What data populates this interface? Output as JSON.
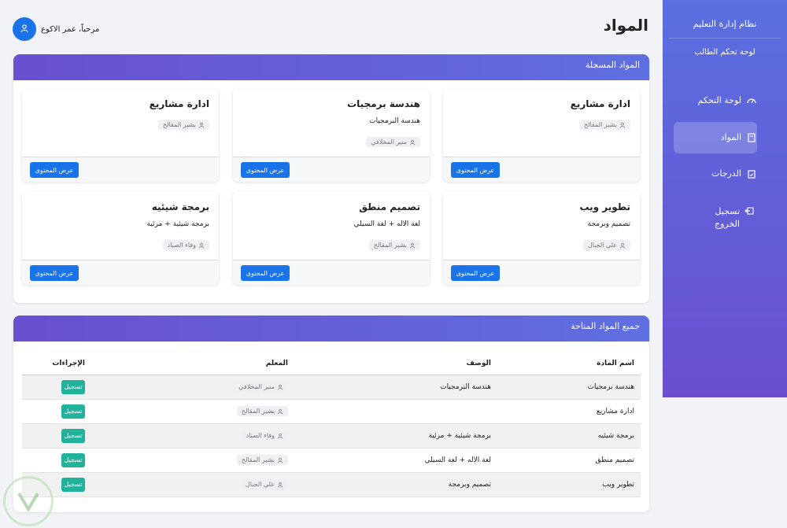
{
  "sidebar": {
    "brand": "نظام إدارة التعليم",
    "subtitle": "لوحة تحكم الطالب",
    "items": [
      {
        "label": "لوحة التحكم",
        "icon": "dashboard-gauge-icon"
      },
      {
        "label": "المواد",
        "icon": "book-icon"
      },
      {
        "label": "الدرجات",
        "icon": "clipboard-check-icon"
      },
      {
        "label": "تسجيل الخروج",
        "icon": "logout-icon"
      }
    ]
  },
  "header": {
    "title": "المواد",
    "greeting": "مرحباً، عمر الاكوع"
  },
  "registered": {
    "heading": "المواد المسجلة",
    "button_label": "عرض المحتوى",
    "cards": [
      {
        "title": "ادارة مشاريع",
        "description": "",
        "teacher": "بشير المقالح"
      },
      {
        "title": "هندسة برمجيات",
        "description": "هندسة البرمجيات",
        "teacher": "منير المخلافي"
      },
      {
        "title": "ادارة مشاريع",
        "description": "",
        "teacher": "بشير المقالح"
      },
      {
        "title": "تطوير ويب",
        "description": "تصميم وبرمجة",
        "teacher": "علي الجبال"
      },
      {
        "title": "تصميم منطق",
        "description": "لغة الاله + لغة السيلي",
        "teacher": "بشير المقالح"
      },
      {
        "title": "برمجة شيئيه",
        "description": "برمجة شيئية + مرئية",
        "teacher": "وفاء الصياد"
      }
    ]
  },
  "available": {
    "heading": "جميع المواد المتاحة",
    "columns": [
      "اسم المادة",
      "الوصف",
      "المعلم",
      "الإجراءات"
    ],
    "action_label": "تسجيل",
    "rows": [
      {
        "name": "هندسة برمجيات",
        "description": "هندسة البرمجيات",
        "teacher": "منير المخلافي"
      },
      {
        "name": "ادارة مشاريع",
        "description": "",
        "teacher": "بشير المقالح"
      },
      {
        "name": "برمجة شيئيه",
        "description": "برمجة شيئية + مرئية",
        "teacher": "وفاء الصياد"
      },
      {
        "name": "تصميم منطق",
        "description": "لغة الاله + لغة السيلي",
        "teacher": "بشير المقالح"
      },
      {
        "name": "تطوير ويب",
        "description": "تصميم وبرمجة",
        "teacher": "علي الجبال"
      }
    ]
  },
  "colors": {
    "accent": "#1a73e8",
    "success": "#20b29a",
    "gradient_start": "#5a6fe0",
    "gradient_end": "#6b4fd0"
  }
}
